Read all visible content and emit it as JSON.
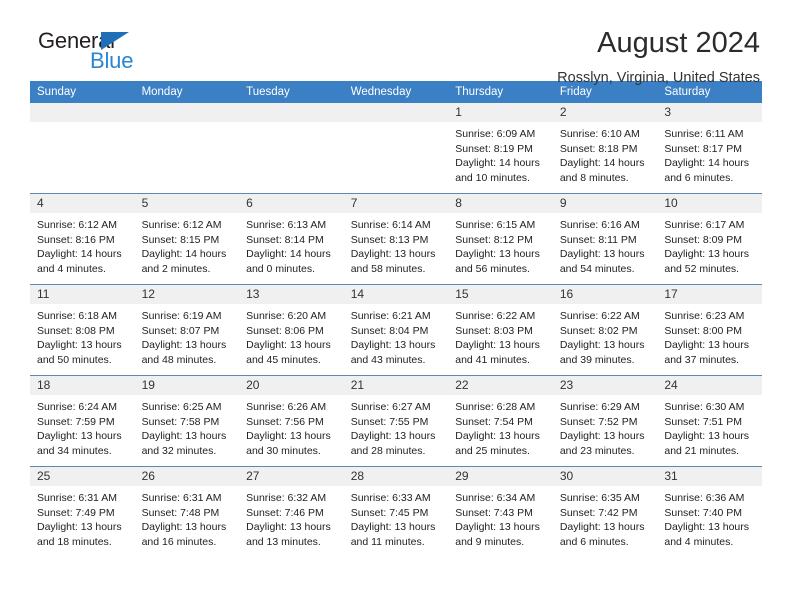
{
  "brand": {
    "name_top": "General",
    "name_bottom": "Blue",
    "accent_color": "#2986d4",
    "triangle_color": "#1f6fb8"
  },
  "header": {
    "title": "August 2024",
    "location": "Rosslyn, Virginia, United States"
  },
  "calendar": {
    "header_color": "#3b7fc4",
    "weekdays": [
      "Sunday",
      "Monday",
      "Tuesday",
      "Wednesday",
      "Thursday",
      "Friday",
      "Saturday"
    ],
    "labels": {
      "sunrise": "Sunrise:",
      "sunset": "Sunset:",
      "daylight": "Daylight:"
    },
    "weeks": [
      [
        {
          "day": "",
          "empty": true
        },
        {
          "day": "",
          "empty": true
        },
        {
          "day": "",
          "empty": true
        },
        {
          "day": "",
          "empty": true
        },
        {
          "day": "1",
          "sunrise": "Sunrise: 6:09 AM",
          "sunset": "Sunset: 8:19 PM",
          "daylight": "Daylight: 14 hours and 10 minutes."
        },
        {
          "day": "2",
          "sunrise": "Sunrise: 6:10 AM",
          "sunset": "Sunset: 8:18 PM",
          "daylight": "Daylight: 14 hours and 8 minutes."
        },
        {
          "day": "3",
          "sunrise": "Sunrise: 6:11 AM",
          "sunset": "Sunset: 8:17 PM",
          "daylight": "Daylight: 14 hours and 6 minutes."
        }
      ],
      [
        {
          "day": "4",
          "sunrise": "Sunrise: 6:12 AM",
          "sunset": "Sunset: 8:16 PM",
          "daylight": "Daylight: 14 hours and 4 minutes."
        },
        {
          "day": "5",
          "sunrise": "Sunrise: 6:12 AM",
          "sunset": "Sunset: 8:15 PM",
          "daylight": "Daylight: 14 hours and 2 minutes."
        },
        {
          "day": "6",
          "sunrise": "Sunrise: 6:13 AM",
          "sunset": "Sunset: 8:14 PM",
          "daylight": "Daylight: 14 hours and 0 minutes."
        },
        {
          "day": "7",
          "sunrise": "Sunrise: 6:14 AM",
          "sunset": "Sunset: 8:13 PM",
          "daylight": "Daylight: 13 hours and 58 minutes."
        },
        {
          "day": "8",
          "sunrise": "Sunrise: 6:15 AM",
          "sunset": "Sunset: 8:12 PM",
          "daylight": "Daylight: 13 hours and 56 minutes."
        },
        {
          "day": "9",
          "sunrise": "Sunrise: 6:16 AM",
          "sunset": "Sunset: 8:11 PM",
          "daylight": "Daylight: 13 hours and 54 minutes."
        },
        {
          "day": "10",
          "sunrise": "Sunrise: 6:17 AM",
          "sunset": "Sunset: 8:09 PM",
          "daylight": "Daylight: 13 hours and 52 minutes."
        }
      ],
      [
        {
          "day": "11",
          "sunrise": "Sunrise: 6:18 AM",
          "sunset": "Sunset: 8:08 PM",
          "daylight": "Daylight: 13 hours and 50 minutes."
        },
        {
          "day": "12",
          "sunrise": "Sunrise: 6:19 AM",
          "sunset": "Sunset: 8:07 PM",
          "daylight": "Daylight: 13 hours and 48 minutes."
        },
        {
          "day": "13",
          "sunrise": "Sunrise: 6:20 AM",
          "sunset": "Sunset: 8:06 PM",
          "daylight": "Daylight: 13 hours and 45 minutes."
        },
        {
          "day": "14",
          "sunrise": "Sunrise: 6:21 AM",
          "sunset": "Sunset: 8:04 PM",
          "daylight": "Daylight: 13 hours and 43 minutes."
        },
        {
          "day": "15",
          "sunrise": "Sunrise: 6:22 AM",
          "sunset": "Sunset: 8:03 PM",
          "daylight": "Daylight: 13 hours and 41 minutes."
        },
        {
          "day": "16",
          "sunrise": "Sunrise: 6:22 AM",
          "sunset": "Sunset: 8:02 PM",
          "daylight": "Daylight: 13 hours and 39 minutes."
        },
        {
          "day": "17",
          "sunrise": "Sunrise: 6:23 AM",
          "sunset": "Sunset: 8:00 PM",
          "daylight": "Daylight: 13 hours and 37 minutes."
        }
      ],
      [
        {
          "day": "18",
          "sunrise": "Sunrise: 6:24 AM",
          "sunset": "Sunset: 7:59 PM",
          "daylight": "Daylight: 13 hours and 34 minutes."
        },
        {
          "day": "19",
          "sunrise": "Sunrise: 6:25 AM",
          "sunset": "Sunset: 7:58 PM",
          "daylight": "Daylight: 13 hours and 32 minutes."
        },
        {
          "day": "20",
          "sunrise": "Sunrise: 6:26 AM",
          "sunset": "Sunset: 7:56 PM",
          "daylight": "Daylight: 13 hours and 30 minutes."
        },
        {
          "day": "21",
          "sunrise": "Sunrise: 6:27 AM",
          "sunset": "Sunset: 7:55 PM",
          "daylight": "Daylight: 13 hours and 28 minutes."
        },
        {
          "day": "22",
          "sunrise": "Sunrise: 6:28 AM",
          "sunset": "Sunset: 7:54 PM",
          "daylight": "Daylight: 13 hours and 25 minutes."
        },
        {
          "day": "23",
          "sunrise": "Sunrise: 6:29 AM",
          "sunset": "Sunset: 7:52 PM",
          "daylight": "Daylight: 13 hours and 23 minutes."
        },
        {
          "day": "24",
          "sunrise": "Sunrise: 6:30 AM",
          "sunset": "Sunset: 7:51 PM",
          "daylight": "Daylight: 13 hours and 21 minutes."
        }
      ],
      [
        {
          "day": "25",
          "sunrise": "Sunrise: 6:31 AM",
          "sunset": "Sunset: 7:49 PM",
          "daylight": "Daylight: 13 hours and 18 minutes."
        },
        {
          "day": "26",
          "sunrise": "Sunrise: 6:31 AM",
          "sunset": "Sunset: 7:48 PM",
          "daylight": "Daylight: 13 hours and 16 minutes."
        },
        {
          "day": "27",
          "sunrise": "Sunrise: 6:32 AM",
          "sunset": "Sunset: 7:46 PM",
          "daylight": "Daylight: 13 hours and 13 minutes."
        },
        {
          "day": "28",
          "sunrise": "Sunrise: 6:33 AM",
          "sunset": "Sunset: 7:45 PM",
          "daylight": "Daylight: 13 hours and 11 minutes."
        },
        {
          "day": "29",
          "sunrise": "Sunrise: 6:34 AM",
          "sunset": "Sunset: 7:43 PM",
          "daylight": "Daylight: 13 hours and 9 minutes."
        },
        {
          "day": "30",
          "sunrise": "Sunrise: 6:35 AM",
          "sunset": "Sunset: 7:42 PM",
          "daylight": "Daylight: 13 hours and 6 minutes."
        },
        {
          "day": "31",
          "sunrise": "Sunrise: 6:36 AM",
          "sunset": "Sunset: 7:40 PM",
          "daylight": "Daylight: 13 hours and 4 minutes."
        }
      ]
    ]
  }
}
